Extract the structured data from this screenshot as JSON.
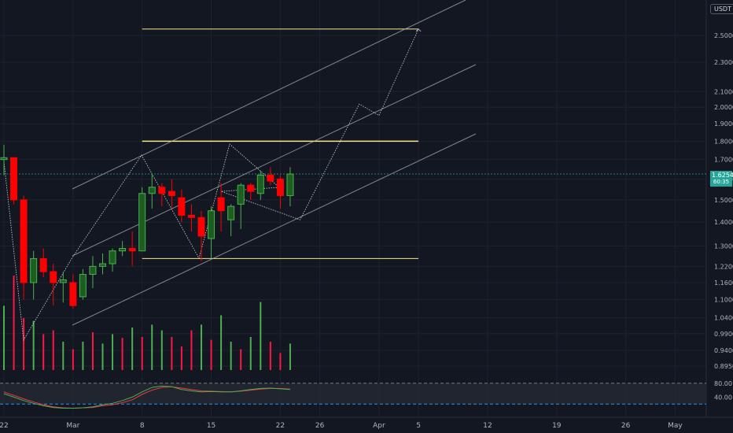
{
  "currency_label": "USDT",
  "price": {
    "last": "1.6254",
    "countdown": "60:35"
  },
  "colors": {
    "bg": "#131722",
    "up": "#26a69a",
    "down": "#ef5350",
    "bull": "#1b5e20",
    "bear": "#ff0000",
    "vol_up": "#4caf50",
    "vol_down": "#ff1744",
    "accent_yellow": "#f7e68b",
    "stoch_k": "#4caf50",
    "stoch_d": "#f23645"
  },
  "chart_data": {
    "type": "candlestick",
    "y_scale": "log",
    "ylim": [
      0.88,
      2.65
    ],
    "y_ticks": [
      "2.5000",
      "2.3000",
      "2.1000",
      "2.0000",
      "1.9000",
      "1.8000",
      "1.7000",
      "1.6000",
      "1.5000",
      "1.4000",
      "1.3000",
      "1.2200",
      "1.1600",
      "1.1000",
      "1.0400",
      "0.9900",
      "0.9400",
      "0.8950"
    ],
    "x_ticks": [
      "22",
      "Mar",
      "8",
      "15",
      "22",
      "26",
      "Apr",
      "5",
      "12",
      "19",
      "26",
      "May"
    ],
    "candles": [
      {
        "date": "Feb 22",
        "o": 1.7,
        "h": 1.78,
        "l": 1.62,
        "c": 1.71
      },
      {
        "date": "Feb 23",
        "o": 1.71,
        "h": 1.71,
        "l": 1.48,
        "c": 1.5
      },
      {
        "date": "Feb 24",
        "o": 1.5,
        "h": 1.52,
        "l": 1.1,
        "c": 1.16
      },
      {
        "date": "Feb 25",
        "o": 1.16,
        "h": 1.28,
        "l": 1.1,
        "c": 1.25
      },
      {
        "date": "Feb 26",
        "o": 1.25,
        "h": 1.29,
        "l": 1.18,
        "c": 1.2
      },
      {
        "date": "Feb 27",
        "o": 1.2,
        "h": 1.23,
        "l": 1.08,
        "c": 1.16
      },
      {
        "date": "Feb 28",
        "o": 1.16,
        "h": 1.2,
        "l": 1.09,
        "c": 1.17
      },
      {
        "date": "Mar 1",
        "o": 1.16,
        "h": 1.19,
        "l": 1.07,
        "c": 1.08
      },
      {
        "date": "Mar 2",
        "o": 1.11,
        "h": 1.21,
        "l": 1.1,
        "c": 1.19
      },
      {
        "date": "Mar 3",
        "o": 1.19,
        "h": 1.26,
        "l": 1.14,
        "c": 1.22
      },
      {
        "date": "Mar 4",
        "o": 1.22,
        "h": 1.27,
        "l": 1.19,
        "c": 1.23
      },
      {
        "date": "Mar 5",
        "o": 1.23,
        "h": 1.29,
        "l": 1.2,
        "c": 1.28
      },
      {
        "date": "Mar 6",
        "o": 1.28,
        "h": 1.32,
        "l": 1.26,
        "c": 1.29
      },
      {
        "date": "Mar 7",
        "o": 1.29,
        "h": 1.36,
        "l": 1.22,
        "c": 1.28
      },
      {
        "date": "Mar 8",
        "o": 1.28,
        "h": 1.56,
        "l": 1.28,
        "c": 1.53
      },
      {
        "date": "Mar 9",
        "o": 1.53,
        "h": 1.63,
        "l": 1.46,
        "c": 1.56
      },
      {
        "date": "Mar 10",
        "o": 1.56,
        "h": 1.58,
        "l": 1.47,
        "c": 1.53
      },
      {
        "date": "Mar 11",
        "o": 1.54,
        "h": 1.6,
        "l": 1.46,
        "c": 1.52
      },
      {
        "date": "Mar 12",
        "o": 1.51,
        "h": 1.55,
        "l": 1.4,
        "c": 1.43
      },
      {
        "date": "Mar 13",
        "o": 1.43,
        "h": 1.48,
        "l": 1.36,
        "c": 1.42
      },
      {
        "date": "Mar 14",
        "o": 1.42,
        "h": 1.45,
        "l": 1.24,
        "c": 1.34
      },
      {
        "date": "Mar 15",
        "o": 1.33,
        "h": 1.47,
        "l": 1.25,
        "c": 1.45
      },
      {
        "date": "Mar 16",
        "o": 1.51,
        "h": 1.58,
        "l": 1.36,
        "c": 1.45
      },
      {
        "date": "Mar 17",
        "o": 1.41,
        "h": 1.48,
        "l": 1.34,
        "c": 1.47
      },
      {
        "date": "Mar 18",
        "o": 1.48,
        "h": 1.58,
        "l": 1.37,
        "c": 1.57
      },
      {
        "date": "Mar 19",
        "o": 1.57,
        "h": 1.58,
        "l": 1.5,
        "c": 1.54
      },
      {
        "date": "Mar 20",
        "o": 1.53,
        "h": 1.64,
        "l": 1.5,
        "c": 1.62
      },
      {
        "date": "Mar 21",
        "o": 1.62,
        "h": 1.66,
        "l": 1.57,
        "c": 1.59
      },
      {
        "date": "Mar 22",
        "o": 1.6,
        "h": 1.62,
        "l": 1.46,
        "c": 1.52
      },
      {
        "date": "Mar 23",
        "o": 1.52,
        "h": 1.66,
        "l": 1.47,
        "c": 1.6254
      }
    ],
    "volume": [
      {
        "v": 0.68,
        "up": true
      },
      {
        "v": 1.0,
        "up": false
      },
      {
        "v": 0.55,
        "up": false
      },
      {
        "v": 0.52,
        "up": true
      },
      {
        "v": 0.38,
        "up": false
      },
      {
        "v": 0.42,
        "up": false
      },
      {
        "v": 0.3,
        "up": true
      },
      {
        "v": 0.22,
        "up": false
      },
      {
        "v": 0.3,
        "up": true
      },
      {
        "v": 0.4,
        "up": false
      },
      {
        "v": 0.28,
        "up": true
      },
      {
        "v": 0.38,
        "up": true
      },
      {
        "v": 0.34,
        "up": false
      },
      {
        "v": 0.45,
        "up": true
      },
      {
        "v": 0.35,
        "up": false
      },
      {
        "v": 0.48,
        "up": true
      },
      {
        "v": 0.42,
        "up": true
      },
      {
        "v": 0.35,
        "up": false
      },
      {
        "v": 0.25,
        "up": false
      },
      {
        "v": 0.42,
        "up": false
      },
      {
        "v": 0.48,
        "up": true
      },
      {
        "v": 0.32,
        "up": false
      },
      {
        "v": 0.58,
        "up": true
      },
      {
        "v": 0.3,
        "up": true
      },
      {
        "v": 0.22,
        "up": false
      },
      {
        "v": 0.35,
        "up": true
      },
      {
        "v": 0.72,
        "up": true
      },
      {
        "v": 0.3,
        "up": false
      },
      {
        "v": 0.18,
        "up": false
      },
      {
        "v": 0.28,
        "up": true
      }
    ],
    "stochastic": {
      "levels": [
        80,
        20
      ],
      "y_labels": [
        "80.00",
        "40.00"
      ],
      "k": [
        50,
        40,
        30,
        22,
        15,
        10,
        8,
        8,
        9,
        12,
        18,
        22,
        30,
        40,
        55,
        68,
        72,
        70,
        62,
        58,
        55,
        56,
        55,
        55,
        58,
        62,
        65,
        66,
        64,
        62
      ],
      "d": [
        55,
        45,
        35,
        26,
        18,
        12,
        9,
        8,
        9,
        10,
        15,
        18,
        24,
        32,
        48,
        60,
        68,
        70,
        66,
        62,
        58,
        57,
        56,
        55,
        57,
        60,
        63,
        65,
        65,
        63
      ]
    },
    "overlays": {
      "horizontal_levels": [
        2.55,
        1.8,
        1.25
      ],
      "projection_path": [
        [
          "Mar 16",
          1.54
        ],
        [
          "Mar 24",
          1.41
        ],
        [
          "Mar 30",
          2.02
        ],
        [
          "Apr 1",
          1.95
        ],
        [
          "Apr 5",
          2.55
        ]
      ]
    }
  }
}
